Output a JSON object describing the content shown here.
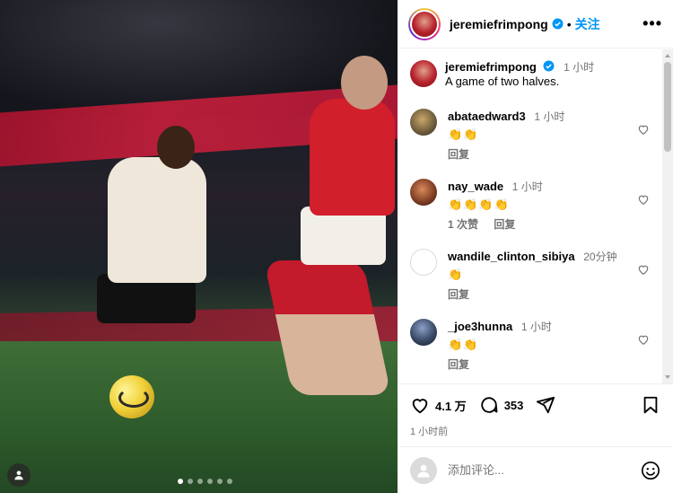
{
  "post": {
    "username": "jeremiefrimpong",
    "follow_label": "关注",
    "more_label": "•••",
    "caption_text": "A game of two halves.",
    "caption_time": "1 小时",
    "carousel_count": 6
  },
  "comments": [
    {
      "username": "abataedward3",
      "time": "1 小时",
      "emoji": "👏👏",
      "reply_label": "回复",
      "likes_label": "",
      "avatar_color": "#6b5a3a"
    },
    {
      "username": "nay_wade",
      "time": "1 小时",
      "emoji": "👏👏👏👏",
      "reply_label": "回复",
      "likes_label": "1 次赞",
      "avatar_color": "#7b3a22"
    },
    {
      "username": "wandile_clinton_sibiya",
      "time": "20分钟",
      "emoji": "👏",
      "reply_label": "回复",
      "likes_label": "",
      "avatar_color": "#ffffff"
    },
    {
      "username": "_joe3hunna",
      "time": "1 小时",
      "emoji": "👏👏",
      "reply_label": "回复",
      "likes_label": "",
      "avatar_color": "#3a4a66"
    }
  ],
  "actions": {
    "likes_count": "4.1 万",
    "comments_count": "353",
    "time_ago": "1 小时前"
  },
  "add_comment": {
    "placeholder": "添加评论..."
  },
  "colors": {
    "accent": "#0095f6",
    "muted": "#737373"
  }
}
